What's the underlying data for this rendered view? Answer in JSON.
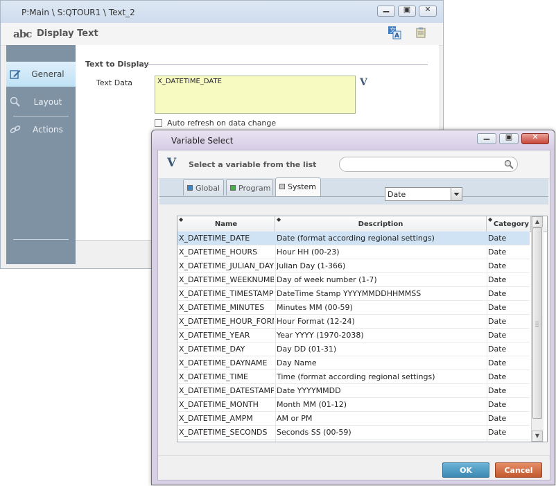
{
  "back_window": {
    "title": "P:Main \\ S:QTOUR1 \\ Text_2",
    "header_title": "Display Text",
    "logo_text": "abc",
    "sidebar": {
      "items": [
        {
          "label": "General",
          "icon": "edit-icon",
          "active": true
        },
        {
          "label": "Layout",
          "icon": "layout-icon",
          "active": false
        },
        {
          "label": "Actions",
          "icon": "actions-icon",
          "active": false
        }
      ]
    },
    "group_label": "Text to Display",
    "text_data_label": "Text Data",
    "text_data_value": "X_DATETIME_DATE",
    "variable_button": "V",
    "auto_refresh_label": "Auto refresh on data change",
    "auto_refresh_checked": false
  },
  "dialog": {
    "title": "Variable Select",
    "header_icon": "V",
    "header_text": "Select a variable from the list",
    "search": {
      "value": "",
      "placeholder": ""
    },
    "tabs": [
      {
        "label": "Global",
        "color": "#3a86c8",
        "active": false
      },
      {
        "label": "Program",
        "color": "#45b045",
        "active": false
      },
      {
        "label": "System",
        "color": "#c8c8c8",
        "active": true
      }
    ],
    "category_filter": "Date",
    "columns": {
      "name": "Name",
      "description": "Description",
      "category": "Category"
    },
    "rows": [
      {
        "name": "X_DATETIME_DATE",
        "description": "Date (format according regional settings)",
        "category": "Date",
        "selected": true
      },
      {
        "name": "X_DATETIME_HOURS",
        "description": "Hour HH (00-23)",
        "category": "Date"
      },
      {
        "name": "X_DATETIME_JULIAN_DAY",
        "description": "Julian Day (1-366)",
        "category": "Date"
      },
      {
        "name": "X_DATETIME_WEEKNUMBE",
        "description": "Day of week number (1-7)",
        "category": "Date"
      },
      {
        "name": "X_DATETIME_TIMESTAMP",
        "description": "DateTime Stamp YYYYMMDDHHMMSS",
        "category": "Date"
      },
      {
        "name": "X_DATETIME_MINUTES",
        "description": "Minutes MM (00-59)",
        "category": "Date"
      },
      {
        "name": "X_DATETIME_HOUR_FORM",
        "description": "Hour Format (12-24)",
        "category": "Date"
      },
      {
        "name": "X_DATETIME_YEAR",
        "description": "Year YYYY (1970-2038)",
        "category": "Date"
      },
      {
        "name": "X_DATETIME_DAY",
        "description": "Day DD (01-31)",
        "category": "Date"
      },
      {
        "name": "X_DATETIME_DAYNAME",
        "description": "Day Name",
        "category": "Date"
      },
      {
        "name": "X_DATETIME_TIME",
        "description": "Time (format according regional settings)",
        "category": "Date"
      },
      {
        "name": "X_DATETIME_DATESTAMP",
        "description": "Date YYYYMMDD",
        "category": "Date"
      },
      {
        "name": "X_DATETIME_MONTH",
        "description": "Month MM (01-12)",
        "category": "Date"
      },
      {
        "name": "X_DATETIME_AMPM",
        "description": "AM or PM",
        "category": "Date"
      },
      {
        "name": "X_DATETIME_SECONDS",
        "description": "Seconds SS (00-59)",
        "category": "Date"
      }
    ],
    "ok_label": "OK",
    "cancel_label": "Cancel"
  }
}
